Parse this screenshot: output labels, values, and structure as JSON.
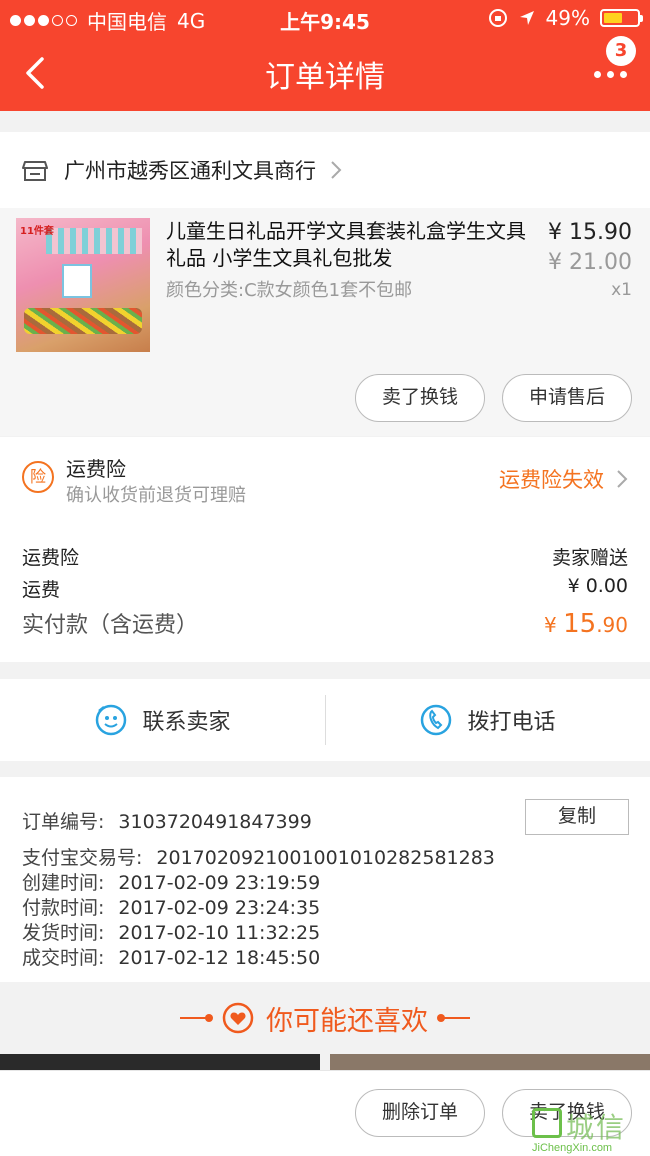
{
  "status_bar": {
    "carrier": "中国电信",
    "network": "4G",
    "time": "上午9:45",
    "battery": "49%"
  },
  "header": {
    "title": "订单详情",
    "badge_count": "3"
  },
  "shop": {
    "name": "广州市越秀区通利文具商行"
  },
  "product": {
    "image_tag": "11件套",
    "name": "儿童生日礼品开学文具套装礼盒学生文具礼品 小学生文具礼包批发",
    "spec": "颜色分类:C款女颜色1套不包邮",
    "price": "¥ 15.90",
    "original_price": "¥ 21.00",
    "quantity": "x1",
    "sell_button": "卖了换钱",
    "after_sale_button": "申请售后"
  },
  "insurance": {
    "icon_text": "险",
    "title": "运费险",
    "subtitle": "确认收货前退货可理赔",
    "status": "运费险失效"
  },
  "costs": {
    "insurance_label": "运费险",
    "insurance_value": "卖家赠送",
    "shipping_label": "运费",
    "shipping_value": "¥ 0.00",
    "total_label": "实付款（含运费）",
    "total_currency": "¥ ",
    "total_integer": "15",
    "total_decimal": ".90"
  },
  "contact": {
    "seller_label": "联系卖家",
    "phone_label": "拨打电话"
  },
  "order_info": {
    "order_no_label": "订单编号:",
    "order_no": "3103720491847399",
    "copy_button": "复制",
    "alipay_label": "支付宝交易号:",
    "alipay_no": "2017020921001001010282581283",
    "created_label": "创建时间:",
    "created": "2017-02-09 23:19:59",
    "paid_label": "付款时间:",
    "paid": "2017-02-09 23:24:35",
    "shipped_label": "发货时间:",
    "shipped": "2017-02-10 11:32:25",
    "completed_label": "成交时间:",
    "completed": "2017-02-12 18:45:50"
  },
  "recommend": {
    "title": "你可能还喜欢"
  },
  "bottom_bar": {
    "delete_button": "删除订单",
    "sell_button": "卖了换钱"
  },
  "watermark": {
    "text": "城信",
    "url": "JiChengXin.com"
  },
  "colors": {
    "header_bg": "#f7452e",
    "accent_orange": "#f47320"
  }
}
